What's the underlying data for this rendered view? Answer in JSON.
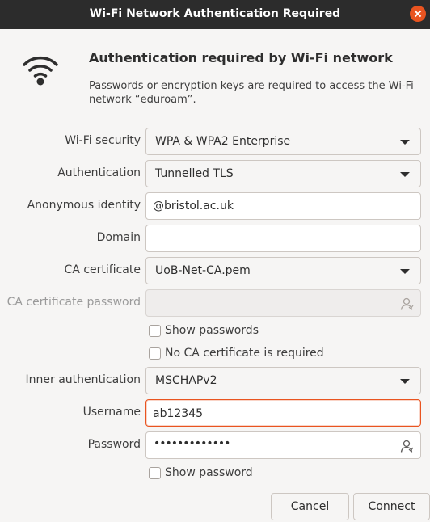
{
  "window": {
    "title": "Wi-Fi Network Authentication Required"
  },
  "header": {
    "heading": "Authentication required by Wi-Fi network",
    "description": "Passwords or encryption keys are required to access the Wi-Fi network “eduroam”."
  },
  "form": {
    "wifi_security": {
      "label": "Wi-Fi security",
      "value": "WPA & WPA2 Enterprise"
    },
    "authentication": {
      "label": "Authentication",
      "value": "Tunnelled TLS"
    },
    "anonymous_identity": {
      "label": "Anonymous identity",
      "value": "@bristol.ac.uk"
    },
    "domain": {
      "label": "Domain",
      "value": ""
    },
    "ca_certificate": {
      "label": "CA certificate",
      "value": "UoB-Net-CA.pem"
    },
    "ca_certificate_password": {
      "label": "CA certificate password",
      "value": ""
    },
    "show_passwords": {
      "label": "Show passwords",
      "checked": false
    },
    "no_ca_required": {
      "label": "No CA certificate is required",
      "checked": false
    },
    "inner_authentication": {
      "label": "Inner authentication",
      "value": "MSCHAPv2"
    },
    "username": {
      "label": "Username",
      "value": "ab12345"
    },
    "password": {
      "label": "Password",
      "masked": "•••••••••••••"
    },
    "show_password": {
      "label": "Show password",
      "checked": false
    }
  },
  "buttons": {
    "cancel": "Cancel",
    "connect": "Connect"
  },
  "colors": {
    "accent": "#e95420",
    "titlebar": "#2c2c2c"
  },
  "icons": {
    "network": "wifi-icon",
    "close": "close-icon",
    "user_type": "user-icon"
  }
}
